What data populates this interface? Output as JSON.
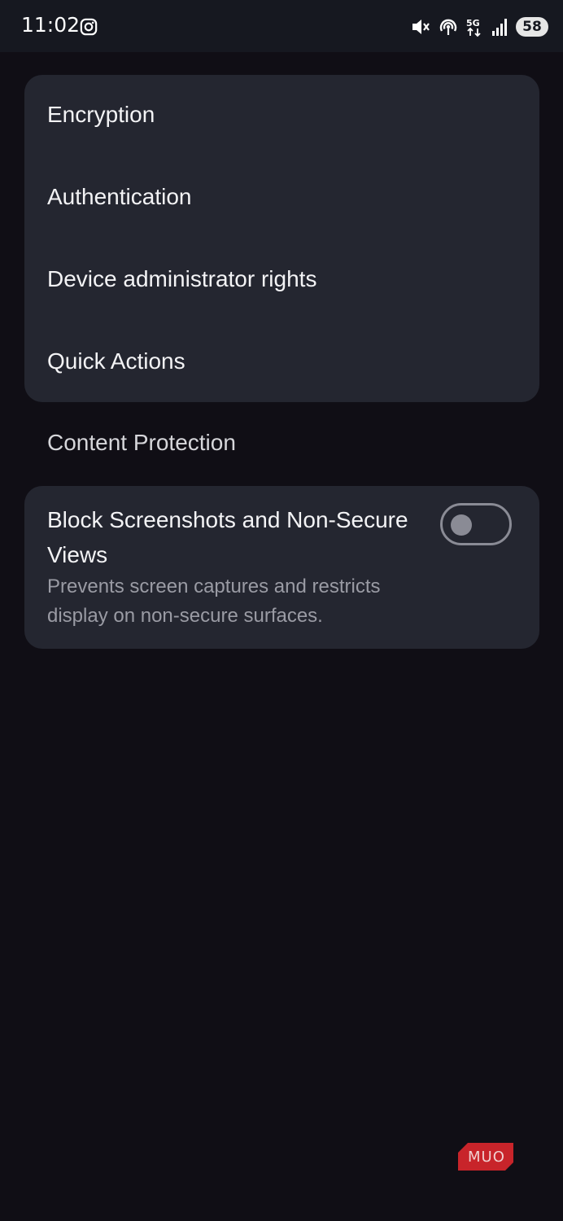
{
  "status_bar": {
    "time": "11:02",
    "left_icons": [
      "instagram-icon"
    ],
    "right_icons": [
      "mute-icon",
      "hotspot-icon",
      "5g-icon",
      "signal-icon"
    ],
    "network_label": "5G",
    "battery": "58"
  },
  "menu": {
    "items": [
      {
        "label": "Encryption"
      },
      {
        "label": "Authentication"
      },
      {
        "label": "Device administrator rights"
      },
      {
        "label": "Quick Actions"
      }
    ]
  },
  "content_protection": {
    "header": "Content Protection",
    "setting": {
      "title": "Block Screenshots and Non-Secure Views",
      "description": "Prevents screen captures and restricts display on non-secure surfaces.",
      "enabled": false
    }
  },
  "watermark": {
    "text": "MUO"
  },
  "colors": {
    "background": "#100e15",
    "card": "#242630",
    "status_bar": "#161820",
    "toggle_off": "#8a8b95",
    "watermark": "#c8242a"
  }
}
